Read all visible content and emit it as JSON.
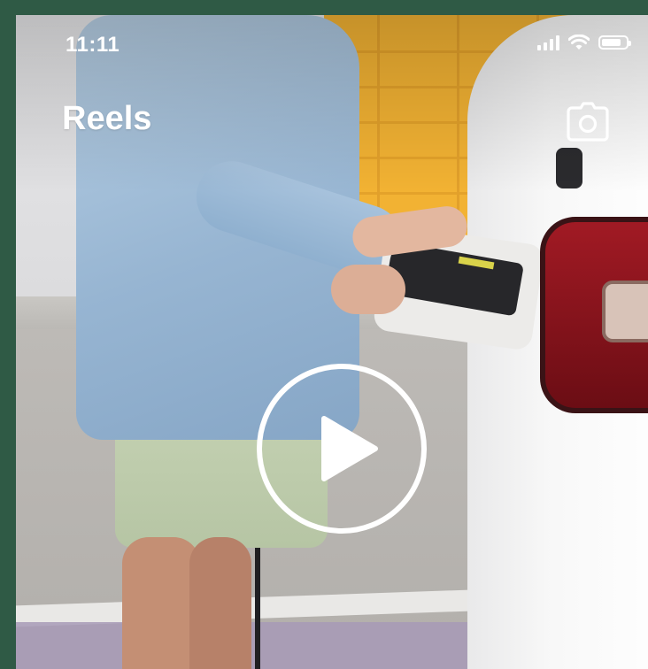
{
  "status_bar": {
    "time": "11:11",
    "signal_icon": "cellular-signal-icon",
    "wifi_icon": "wifi-icon",
    "battery_icon": "battery-icon",
    "battery_level": 0.8
  },
  "header": {
    "title": "Reels",
    "camera_icon": "camera-icon"
  },
  "video": {
    "play_icon": "play-icon",
    "overlay_color": "#ffffff"
  },
  "colors": {
    "frame_border": "#2f5a45",
    "accent": "#f2b233"
  }
}
